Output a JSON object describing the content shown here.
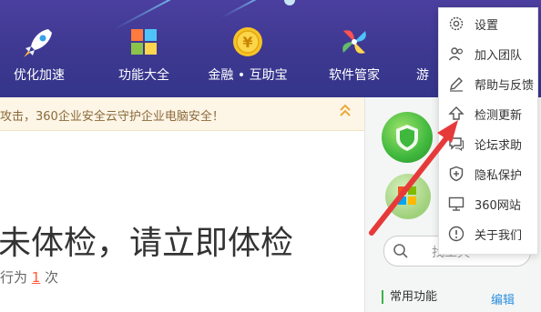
{
  "nav": {
    "items": [
      {
        "label": "优化加速",
        "icon": "rocket-icon"
      },
      {
        "label": "功能大全",
        "icon": "grid-icon"
      },
      {
        "label": "金融 • 互助宝",
        "icon": "coin-icon"
      },
      {
        "label": "软件管家",
        "icon": "pinwheel-icon"
      }
    ],
    "partial_label": "游"
  },
  "notice": {
    "text": "攻击，360企业安全云守护企业电脑安全！",
    "chevron_icon": "double-chevron-up-icon"
  },
  "main": {
    "headline": "未体检，请立即体检",
    "sub_prefix": "行为",
    "sub_count": "1",
    "sub_suffix": "次"
  },
  "side": {
    "search_placeholder": "找工具",
    "common_label": "常用功能",
    "edit_label": "编辑"
  },
  "menu": {
    "items": [
      {
        "label": "设置",
        "icon": "gear-icon"
      },
      {
        "label": "加入团队",
        "icon": "users-icon"
      },
      {
        "label": "帮助与反馈",
        "icon": "pencil-icon"
      },
      {
        "label": "检测更新",
        "icon": "upload-icon"
      },
      {
        "label": "论坛求助",
        "icon": "chat-icon"
      },
      {
        "label": "隐私保护",
        "icon": "shield-icon"
      },
      {
        "label": "360网站",
        "icon": "monitor-icon"
      },
      {
        "label": "关于我们",
        "icon": "info-icon"
      }
    ]
  },
  "colors": {
    "header_bg": "#3d3890",
    "accent_green": "#3bb34a",
    "link_blue": "#2f8fdf",
    "arrow_red": "#e63a3a",
    "notice_bg": "#fdf5e6"
  }
}
